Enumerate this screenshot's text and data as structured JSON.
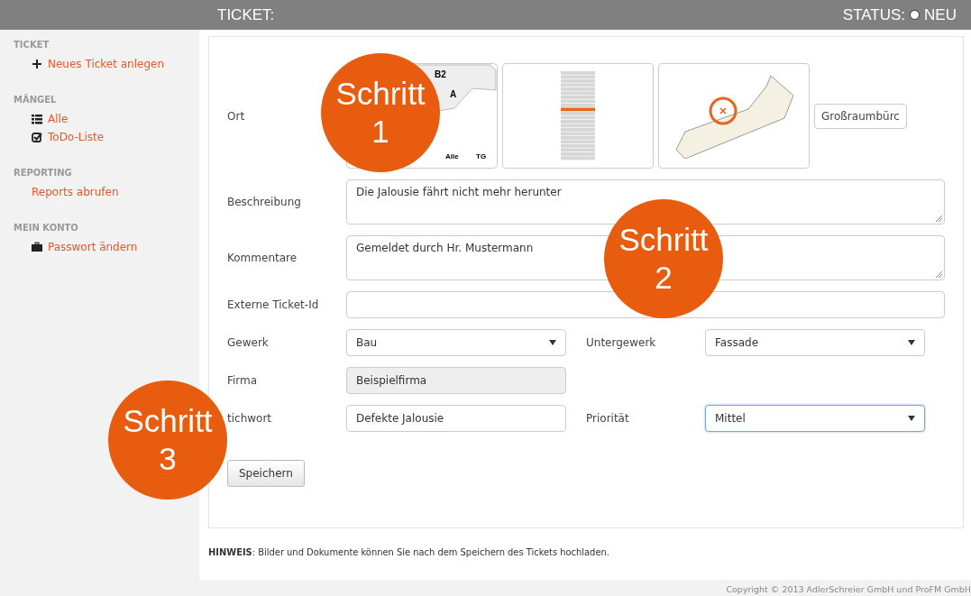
{
  "header": {
    "title": "TICKET:",
    "status_label": "STATUS:",
    "status": "NEU"
  },
  "sidebar": {
    "sections": [
      {
        "heading": "TICKET",
        "items": [
          {
            "label": "Neues Ticket anlegen"
          }
        ]
      },
      {
        "heading": "MÄNGEL",
        "items": [
          {
            "label": "Alle"
          },
          {
            "label": "ToDo-Liste"
          }
        ]
      },
      {
        "heading": "REPORTING",
        "items": [
          {
            "label": "Reports abrufen"
          }
        ]
      },
      {
        "heading": "MEIN KONTO",
        "items": [
          {
            "label": "Passwort ändern"
          }
        ]
      }
    ]
  },
  "form": {
    "location": {
      "label": "Ort",
      "map_labels": [
        "B2",
        "A",
        "Alle",
        "TG"
      ],
      "room": "Großraumbürc"
    },
    "rows": [
      {
        "kind": "textarea",
        "label": "Beschreibung",
        "value": "Die Jalousie fährt nicht mehr herunter"
      },
      {
        "kind": "textarea",
        "label": "Kommentare",
        "value": "Gemeldet durch Hr. Mustermann"
      },
      {
        "kind": "text",
        "label": "Externe Ticket-Id"
      },
      {
        "kind": "select",
        "label": "Gewerk",
        "value": "Bau",
        "side": {
          "kind": "select",
          "label": "Untergewerk",
          "value": "Fassade",
          "focused": false
        }
      },
      {
        "kind": "text",
        "label": "Firma",
        "value": "Beispielfirma",
        "disabled": true
      },
      {
        "kind": "text",
        "label": "tichwort",
        "value": "Defekte Jalousie",
        "side": {
          "kind": "select",
          "label": "Priorität",
          "value": "Mittel",
          "focused": true
        }
      }
    ],
    "save": "Speichern"
  },
  "hint": "**HINWEIS**: Bilder und Dokumente können Sie nach dem Speichern des Tickets hochladen.",
  "copyright": "Copyright © 2013 AdlerSchreier GmbH und ProFM GmbH",
  "callouts": [
    {
      "label": "Schritt 1"
    },
    {
      "label": "Schritt 2"
    },
    {
      "label": "Schritt 3"
    }
  ]
}
